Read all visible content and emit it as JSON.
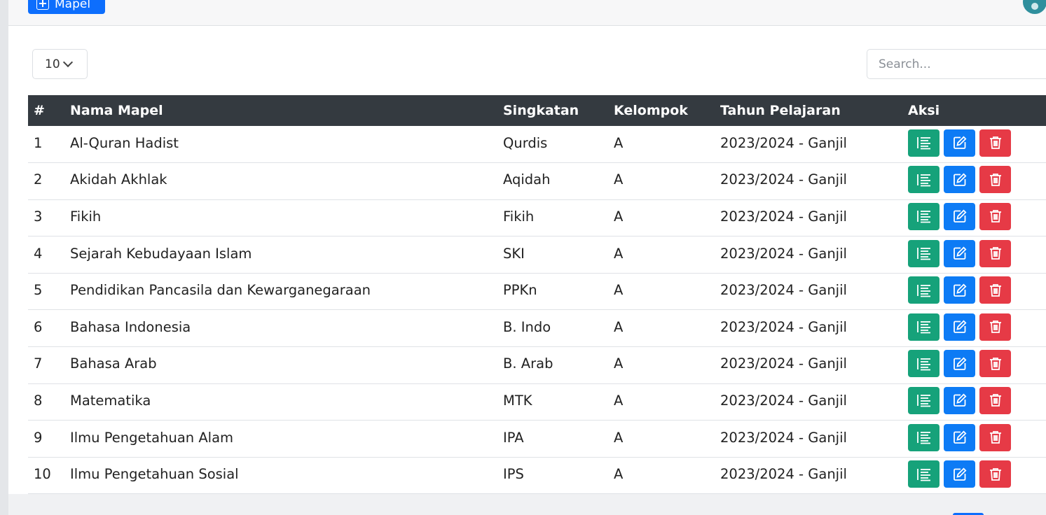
{
  "toolbar": {
    "add_label": "Mapel"
  },
  "controls": {
    "page_length": "10",
    "search_placeholder": "Search..."
  },
  "table": {
    "headers": {
      "no": "#",
      "nama": "Nama Mapel",
      "singkatan": "Singkatan",
      "kelompok": "Kelompok",
      "tahun": "Tahun Pelajaran",
      "aksi": "Aksi"
    },
    "rows": [
      {
        "no": "1",
        "nama": "Al-Quran Hadist",
        "singkatan": "Qurdis",
        "kelompok": "A",
        "tahun": "2023/2024 - Ganjil"
      },
      {
        "no": "2",
        "nama": "Akidah Akhlak",
        "singkatan": "Aqidah",
        "kelompok": "A",
        "tahun": "2023/2024 - Ganjil"
      },
      {
        "no": "3",
        "nama": "Fikih",
        "singkatan": "Fikih",
        "kelompok": "A",
        "tahun": "2023/2024 - Ganjil"
      },
      {
        "no": "4",
        "nama": "Sejarah Kebudayaan Islam",
        "singkatan": "SKI",
        "kelompok": "A",
        "tahun": "2023/2024 - Ganjil"
      },
      {
        "no": "5",
        "nama": "Pendidikan Pancasila dan Kewarganegaraan",
        "singkatan": "PPKn",
        "kelompok": "A",
        "tahun": "2023/2024 - Ganjil"
      },
      {
        "no": "6",
        "nama": "Bahasa Indonesia",
        "singkatan": "B. Indo",
        "kelompok": "A",
        "tahun": "2023/2024 - Ganjil"
      },
      {
        "no": "7",
        "nama": "Bahasa Arab",
        "singkatan": "B. Arab",
        "kelompok": "A",
        "tahun": "2023/2024 - Ganjil"
      },
      {
        "no": "8",
        "nama": "Matematika",
        "singkatan": "MTK",
        "kelompok": "A",
        "tahun": "2023/2024 - Ganjil"
      },
      {
        "no": "9",
        "nama": "Ilmu Pengetahuan Alam",
        "singkatan": "IPA",
        "kelompok": "A",
        "tahun": "2023/2024 - Ganjil"
      },
      {
        "no": "10",
        "nama": "Ilmu Pengetahuan Sosial",
        "singkatan": "IPS",
        "kelompok": "A",
        "tahun": "2023/2024 - Ganjil"
      }
    ]
  },
  "icons": {
    "detail": "list-icon",
    "edit": "edit-icon",
    "delete": "trash-icon",
    "add": "plus-square-icon",
    "length": "chevron-down-icon"
  },
  "colors": {
    "primary": "#0d6efd",
    "success": "#16a27a",
    "danger": "#e63a46",
    "header_bg": "#343a40"
  }
}
